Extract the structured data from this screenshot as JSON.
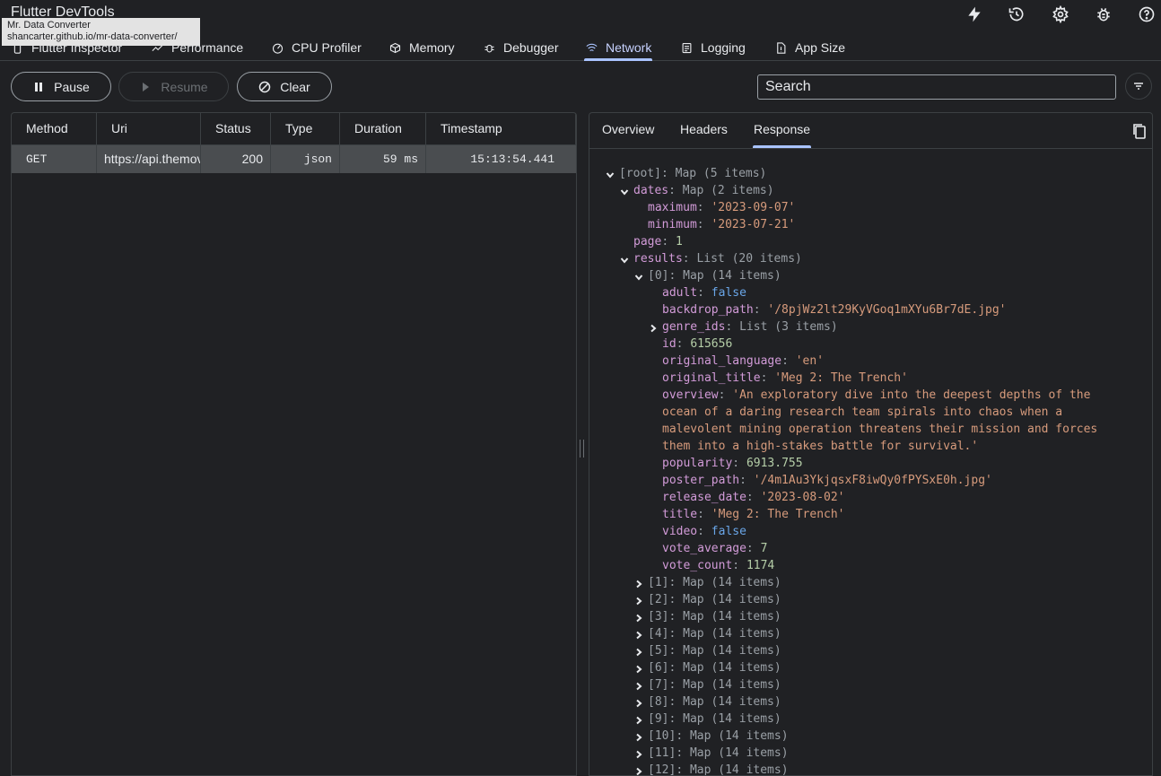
{
  "app": {
    "title": "Flutter DevTools"
  },
  "tooltip": {
    "title": "Mr. Data Converter",
    "url": "shancarter.github.io/mr-data-converter/"
  },
  "top_icons": [
    "flash-icon",
    "history-icon",
    "settings-icon",
    "bug-icon",
    "help-icon"
  ],
  "tabs": [
    {
      "label": "Flutter Inspector",
      "icon": "phone-icon"
    },
    {
      "label": "Performance",
      "icon": "performance-icon"
    },
    {
      "label": "CPU Profiler",
      "icon": "cpu-profiler-icon"
    },
    {
      "label": "Memory",
      "icon": "memory-icon"
    },
    {
      "label": "Debugger",
      "icon": "debugger-icon"
    },
    {
      "label": "Network",
      "icon": "network-icon",
      "active": true
    },
    {
      "label": "Logging",
      "icon": "logging-icon"
    },
    {
      "label": "App Size",
      "icon": "app-size-icon"
    }
  ],
  "controls": {
    "pause": "Pause",
    "resume": "Resume",
    "clear": "Clear",
    "search_placeholder": "Search"
  },
  "table": {
    "columns": [
      "Method",
      "Uri",
      "Status",
      "Type",
      "Duration",
      "Timestamp"
    ],
    "rows": [
      {
        "method": "GET",
        "uri": "https://api.themoviedb.org",
        "status": "200",
        "type": "json",
        "duration": "59 ms",
        "timestamp": "15:13:54.441"
      }
    ]
  },
  "details": {
    "tabs": [
      "Overview",
      "Headers",
      "Response"
    ],
    "active_tab": "Response"
  },
  "tree": {
    "root": {
      "key": "[root]",
      "meta": "Map (5 items)"
    },
    "dates": {
      "key": "dates",
      "meta": "Map (2 items)"
    },
    "maximum": {
      "key": "maximum",
      "value": "'2023-09-07'"
    },
    "minimum": {
      "key": "minimum",
      "value": "'2023-07-21'"
    },
    "page": {
      "key": "page",
      "value": "1"
    },
    "results": {
      "key": "results",
      "meta": "List (20 items)"
    },
    "item0": {
      "key": "[0]",
      "meta": "Map (14 items)"
    },
    "adult": {
      "key": "adult",
      "value": "false"
    },
    "backdrop_path": {
      "key": "backdrop_path",
      "value": "'/8pjWz2lt29KyVGoq1mXYu6Br7dE.jpg'"
    },
    "genre_ids": {
      "key": "genre_ids",
      "meta": "List (3 items)"
    },
    "id": {
      "key": "id",
      "value": "615656"
    },
    "original_language": {
      "key": "original_language",
      "value": "'en'"
    },
    "original_title": {
      "key": "original_title",
      "value": "'Meg 2: The Trench'"
    },
    "overview": {
      "key": "overview",
      "lines": [
        "'An exploratory dive into the deepest depths of the",
        "ocean of a daring research team spirals into chaos when a",
        "malevolent mining operation threatens their mission and forces",
        "them into a high-stakes battle for survival.'"
      ]
    },
    "popularity": {
      "key": "popularity",
      "value": "6913.755"
    },
    "poster_path": {
      "key": "poster_path",
      "value": "'/4m1Au3YkjqsxF8iwQy0fPYSxE0h.jpg'"
    },
    "release_date": {
      "key": "release_date",
      "value": "'2023-08-02'"
    },
    "title": {
      "key": "title",
      "value": "'Meg 2: The Trench'"
    },
    "video": {
      "key": "video",
      "value": "false"
    },
    "vote_average": {
      "key": "vote_average",
      "value": "7"
    },
    "vote_count": {
      "key": "vote_count",
      "value": "1174"
    },
    "collapsed_items": [
      {
        "key": "[1]",
        "meta": "Map (14 items)"
      },
      {
        "key": "[2]",
        "meta": "Map (14 items)"
      },
      {
        "key": "[3]",
        "meta": "Map (14 items)"
      },
      {
        "key": "[4]",
        "meta": "Map (14 items)"
      },
      {
        "key": "[5]",
        "meta": "Map (14 items)"
      },
      {
        "key": "[6]",
        "meta": "Map (14 items)"
      },
      {
        "key": "[7]",
        "meta": "Map (14 items)"
      },
      {
        "key": "[8]",
        "meta": "Map (14 items)"
      },
      {
        "key": "[9]",
        "meta": "Map (14 items)"
      },
      {
        "key": "[10]",
        "meta": "Map (14 items)"
      },
      {
        "key": "[11]",
        "meta": "Map (14 items)"
      },
      {
        "key": "[12]",
        "meta": "Map (14 items)"
      }
    ]
  }
}
